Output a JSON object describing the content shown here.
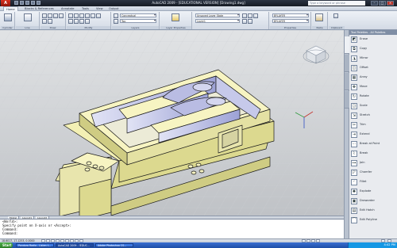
{
  "titlebar": {
    "app_logo": "A",
    "title": "AutoCAD 2009 - [EDUCATIONAL VERSION] [Drawing1.dwg]",
    "search_placeholder": "Type a keyword or phrase"
  },
  "ribbon_tabs": [
    "Home",
    "Blocks & References",
    "Annotate",
    "Tools",
    "View",
    "Output"
  ],
  "ribbon": {
    "panels": [
      {
        "label": "Cylinder"
      },
      {
        "label": "Line"
      },
      {
        "label": "Draw"
      },
      {
        "label": "Modify"
      },
      {
        "label": "Layers"
      },
      {
        "label": "Layer Properties"
      },
      {
        "label": "Properties"
      },
      {
        "label": "Paste"
      },
      {
        "label": "Clipboard"
      }
    ],
    "visual_style": "Conceptual",
    "view": "Top",
    "layer_state": "Unsaved Layer State",
    "layer": "Layer1",
    "color": "BYLAYER",
    "linetype": "BYLAYER"
  },
  "palette": {
    "header": "Tool Palettes - All Palettes",
    "items": [
      {
        "label": "Erase",
        "icon": "eraser-icon"
      },
      {
        "label": "Copy",
        "icon": "copy-icon"
      },
      {
        "label": "Mirror",
        "icon": "mirror-icon"
      },
      {
        "label": "Offset",
        "icon": "offset-icon"
      },
      {
        "label": "Array",
        "icon": "array-icon"
      },
      {
        "label": "Move",
        "icon": "move-icon"
      },
      {
        "label": "Rotate",
        "icon": "rotate-icon"
      },
      {
        "label": "Scale",
        "icon": "scale-icon"
      },
      {
        "label": "Stretch",
        "icon": "stretch-icon"
      },
      {
        "label": "Trim",
        "icon": "trim-icon"
      },
      {
        "label": "Extend",
        "icon": "extend-icon"
      },
      {
        "label": "Break at Point",
        "icon": "break-point-icon"
      },
      {
        "label": "Break",
        "icon": "break-icon"
      },
      {
        "label": "Join",
        "icon": "join-icon"
      },
      {
        "label": "Chamfer",
        "icon": "chamfer-icon"
      },
      {
        "label": "Fillet",
        "icon": "fillet-icon"
      },
      {
        "label": "Explode",
        "icon": "explode-icon"
      },
      {
        "label": "Draworder",
        "icon": "draworder-icon"
      },
      {
        "label": "Edit Hatch",
        "icon": "hatch-icon"
      },
      {
        "label": "Edit Polyline",
        "icon": "polyline-icon"
      }
    ]
  },
  "model_tabs": [
    "Model",
    "Layout1",
    "Layout2"
  ],
  "command_line": [
    "<World>:",
    "Specify point on X-axis or <Accept>:",
    "Command:",
    "Command:"
  ],
  "statusbar": {
    "coords": "18.6017, 17.1253, 0.0000"
  },
  "taskbar": {
    "start": "Start",
    "tasks": [
      "Pandora Radio - Listen t...",
      "AutoCAD 2009 - [EDUC...",
      "Adobe Photoshop CS..."
    ],
    "clock": "4:42 PM"
  },
  "colors": {
    "model_face": "#f3f0b4",
    "model_edge": "#1b1b1b",
    "inner_wall": "#b9bce3",
    "viewport_top": "#e1e3e5",
    "viewport_bottom": "#bfc2c6"
  }
}
